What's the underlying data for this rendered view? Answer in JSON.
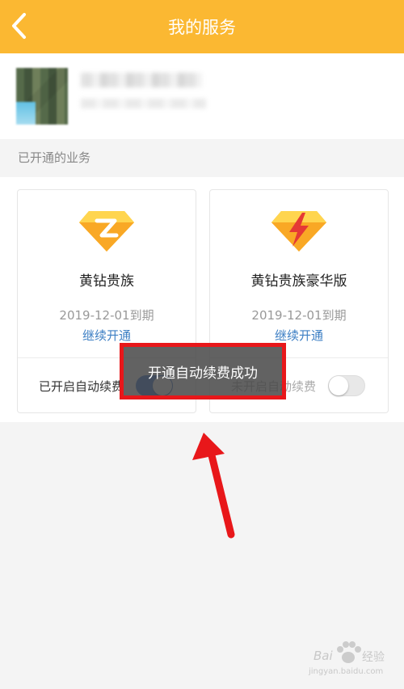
{
  "header": {
    "title": "我的服务",
    "back_icon": "chevron-left-icon"
  },
  "section": {
    "label": "已开通的业务"
  },
  "services": [
    {
      "name": "黄钻贵族",
      "expiry": "2019-12-01到期",
      "renew_label": "继续开通",
      "auto_renew_label": "已开启自动续费",
      "auto_renew_on": true,
      "icon": "yellow-diamond-z-icon"
    },
    {
      "name": "黄钻贵族豪华版",
      "expiry": "2019-12-01到期",
      "renew_label": "继续开通",
      "auto_renew_label": "未开启自动续费",
      "auto_renew_on": false,
      "icon": "yellow-diamond-lightning-icon"
    }
  ],
  "toast": {
    "message": "开通自动续费成功"
  },
  "watermark": {
    "brand": "Bai",
    "suffix": "经验",
    "url": "jingyan.baidu.com"
  },
  "colors": {
    "header": "#fbb832",
    "accent_link": "#3d7fc4",
    "toggle_on": "#2a6fd6",
    "highlight_red": "#e8171a"
  }
}
